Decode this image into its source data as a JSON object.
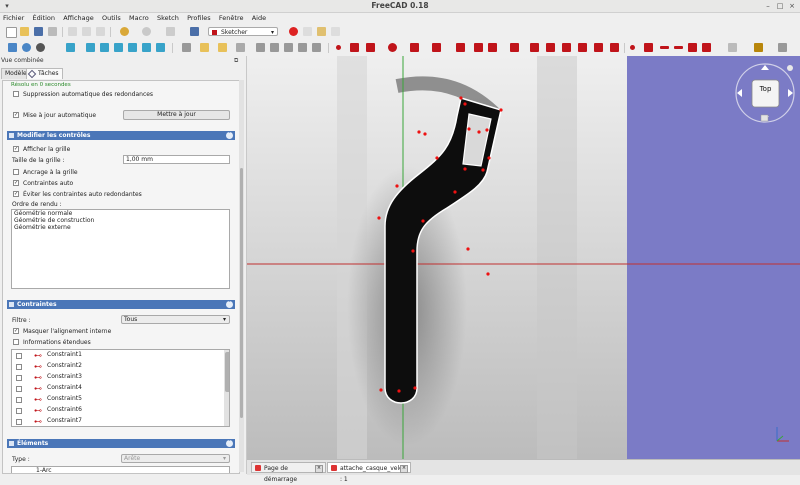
{
  "window": {
    "title": "FreeCAD 0.18"
  },
  "menubar": [
    "Fichier",
    "Édition",
    "Affichage",
    "Outils",
    "Macro",
    "Sketch",
    "Profiles",
    "Fenêtre",
    "Aide"
  ],
  "workbench": {
    "selected": "Sketcher"
  },
  "combo_view": {
    "title": "Vue combinée",
    "tabs": [
      "Modèle",
      "Tâches"
    ],
    "solver": {
      "status": "Résolu en 0 secondes",
      "auto_remove_redundants": "Suppression automatique des redondances",
      "auto_update": "Mise à jour automatique",
      "update_button": "Mettre à jour"
    },
    "edit_controls": {
      "header": "Modifier les contrôles",
      "show_grid": "Afficher la grille",
      "grid_size_label": "Taille de la grille :",
      "grid_size_value": "1,00 mm",
      "grid_snap": "Ancrage à la grille",
      "auto_constraints": "Contraintes auto",
      "avoid_redundant": "Éviter les contraintes auto redondantes",
      "render_order_label": "Ordre de rendu :",
      "render_order": [
        "Géométrie normale",
        "Géométrie de construction",
        "Géométrie externe"
      ]
    },
    "constraints": {
      "header": "Contraintes",
      "filter_label": "Filtre :",
      "filter_value": "Tous",
      "hide_internal": "Masquer l'alignement interne",
      "extended_info": "Informations étendues",
      "items": [
        "Constraint1",
        "Constraint2",
        "Constraint3",
        "Constraint4",
        "Constraint5",
        "Constraint6",
        "Constraint7"
      ]
    },
    "elements": {
      "header": "Éléments",
      "type_label": "Type :",
      "type_value": "Arête",
      "first_item": "1-Arc"
    }
  },
  "navcube": {
    "face": "Top"
  },
  "doc_tabs": [
    "Page de démarrage",
    "attache_casque_velo : 1"
  ],
  "colors": {
    "accent": "#4a76b8",
    "constraint_red": "#c0141a",
    "view_bg": "#7b7bc6"
  }
}
